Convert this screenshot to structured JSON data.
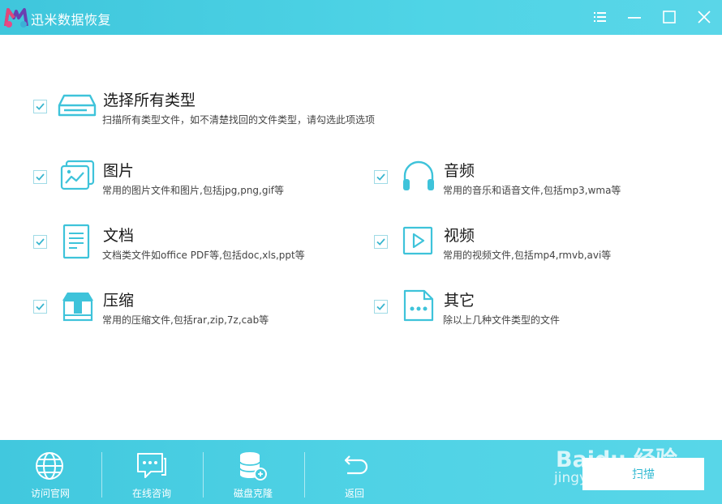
{
  "app": {
    "title": "迅米数据恢复",
    "colors": {
      "accent": "#45CCE0",
      "icon": "#3EC3DA",
      "checkbox_border": "#9FDBE6"
    }
  },
  "window_controls": [
    {
      "name": "menu-icon"
    },
    {
      "name": "minimize-icon"
    },
    {
      "name": "maximize-icon"
    },
    {
      "name": "close-icon"
    }
  ],
  "options": {
    "all": {
      "title": "选择所有类型",
      "desc": "扫描所有类型文件，如不清楚找回的文件类型，请勾选此项选项",
      "checked": true,
      "icon": "drive-icon"
    },
    "images": {
      "title": "图片",
      "desc": "常用的图片文件和图片,包括jpg,png,gif等",
      "checked": true,
      "icon": "image-icon"
    },
    "audio": {
      "title": "音频",
      "desc": "常用的音乐和语音文件,包括mp3,wma等",
      "checked": true,
      "icon": "headphones-icon"
    },
    "docs": {
      "title": "文档",
      "desc": "文档类文件如office PDF等,包括doc,xls,ppt等",
      "checked": true,
      "icon": "document-icon"
    },
    "video": {
      "title": "视频",
      "desc": "常用的视频文件,包括mp4,rmvb,avi等",
      "checked": true,
      "icon": "video-play-icon"
    },
    "archives": {
      "title": "压缩",
      "desc": "常用的压缩文件,包括rar,zip,7z,cab等",
      "checked": true,
      "icon": "archive-box-icon"
    },
    "other": {
      "title": "其它",
      "desc": "除以上几种文件类型的文件",
      "checked": true,
      "icon": "other-file-icon"
    }
  },
  "bottom_bar": {
    "visit_site": "访问官网",
    "online_consult": "在线咨询",
    "disk_clone": "磁盘克隆",
    "back": "返回",
    "scan": "扫描"
  },
  "watermark": {
    "brand": "Baidu 经验",
    "url": "jingyan.baidu.com"
  }
}
